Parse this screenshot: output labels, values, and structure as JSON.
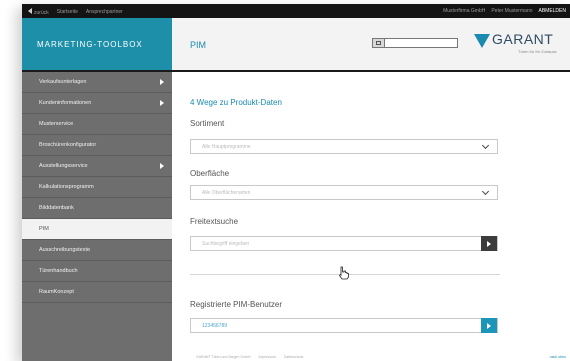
{
  "topbar": {
    "back_label": "zurück",
    "links": [
      "Startseite",
      "Ansprechpartner"
    ],
    "company": "Musterfirma GmbH",
    "user": "Peter Mustermann",
    "logout": "ABMELDEN"
  },
  "header": {
    "brand": "MARKETING-TOOLBOX",
    "module": "PIM",
    "search_placeholder": "",
    "logo_name": "GARANT",
    "logo_slogan": "Türen für Ihr Zuhause"
  },
  "sidebar": {
    "items": [
      {
        "label": "Verkaufsunterlagen",
        "has_sub": true,
        "active": false
      },
      {
        "label": "Kundeninformationen",
        "has_sub": true,
        "active": false
      },
      {
        "label": "Musterservice",
        "has_sub": false,
        "active": false
      },
      {
        "label": "Broschürenkonfigurator",
        "has_sub": false,
        "active": false
      },
      {
        "label": "Ausstellungsservice",
        "has_sub": true,
        "active": false
      },
      {
        "label": "Kalkulationsprogramm",
        "has_sub": false,
        "active": false
      },
      {
        "label": "Bilddatenbank",
        "has_sub": false,
        "active": false
      },
      {
        "label": "PIM",
        "has_sub": false,
        "active": true
      },
      {
        "label": "Ausschreibungstexte",
        "has_sub": false,
        "active": false
      },
      {
        "label": "Türenhandbuch",
        "has_sub": false,
        "active": false
      },
      {
        "label": "RaumKonzept",
        "has_sub": false,
        "active": false
      }
    ]
  },
  "main": {
    "section_title": "4 Wege zu Produkt-Daten",
    "sortiment": {
      "label": "Sortiment",
      "placeholder": "Alle Hauptprogramme"
    },
    "oberflaeche": {
      "label": "Oberfläche",
      "placeholder": "Alle Oberflächenarten"
    },
    "freitext": {
      "label": "Freitextsuche",
      "placeholder": "Suchbegriff eingeben"
    },
    "pim_user": {
      "label": "Registrierte PIM-Benutzer",
      "value": "123456789"
    }
  },
  "footer": {
    "links": [
      "GARANT Türen und Zargen GmbH",
      "Impressum",
      "Datenschutz"
    ],
    "right": "nach oben"
  },
  "colors": {
    "accent": "#1a8ab0",
    "brand_bg": "#1e8fa8",
    "sidebar_bg": "#6e6e6e",
    "topbar_bg": "#141414"
  }
}
